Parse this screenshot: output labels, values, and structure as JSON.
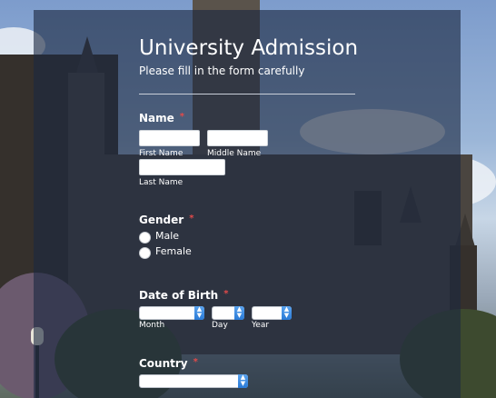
{
  "form": {
    "title": "University Admission",
    "subtitle": "Please fill in the form carefully"
  },
  "name_field": {
    "label": "Name",
    "required_mark": "*",
    "first_name_label": "First Name",
    "middle_name_label": "Middle Name",
    "last_name_label": "Last Name",
    "first_name_value": "",
    "middle_name_value": "",
    "last_name_value": ""
  },
  "gender_field": {
    "label": "Gender",
    "required_mark": "*",
    "options": [
      "Male",
      "Female"
    ]
  },
  "dob_field": {
    "label": "Date of Birth",
    "required_mark": "*",
    "month_label": "Month",
    "day_label": "Day",
    "year_label": "Year"
  },
  "country_field": {
    "label": "Country",
    "required_mark": "*"
  },
  "colors": {
    "panel_overlay": "#1c2840",
    "required": "#e24a4a",
    "select_arrow": "#2a7ad6"
  }
}
